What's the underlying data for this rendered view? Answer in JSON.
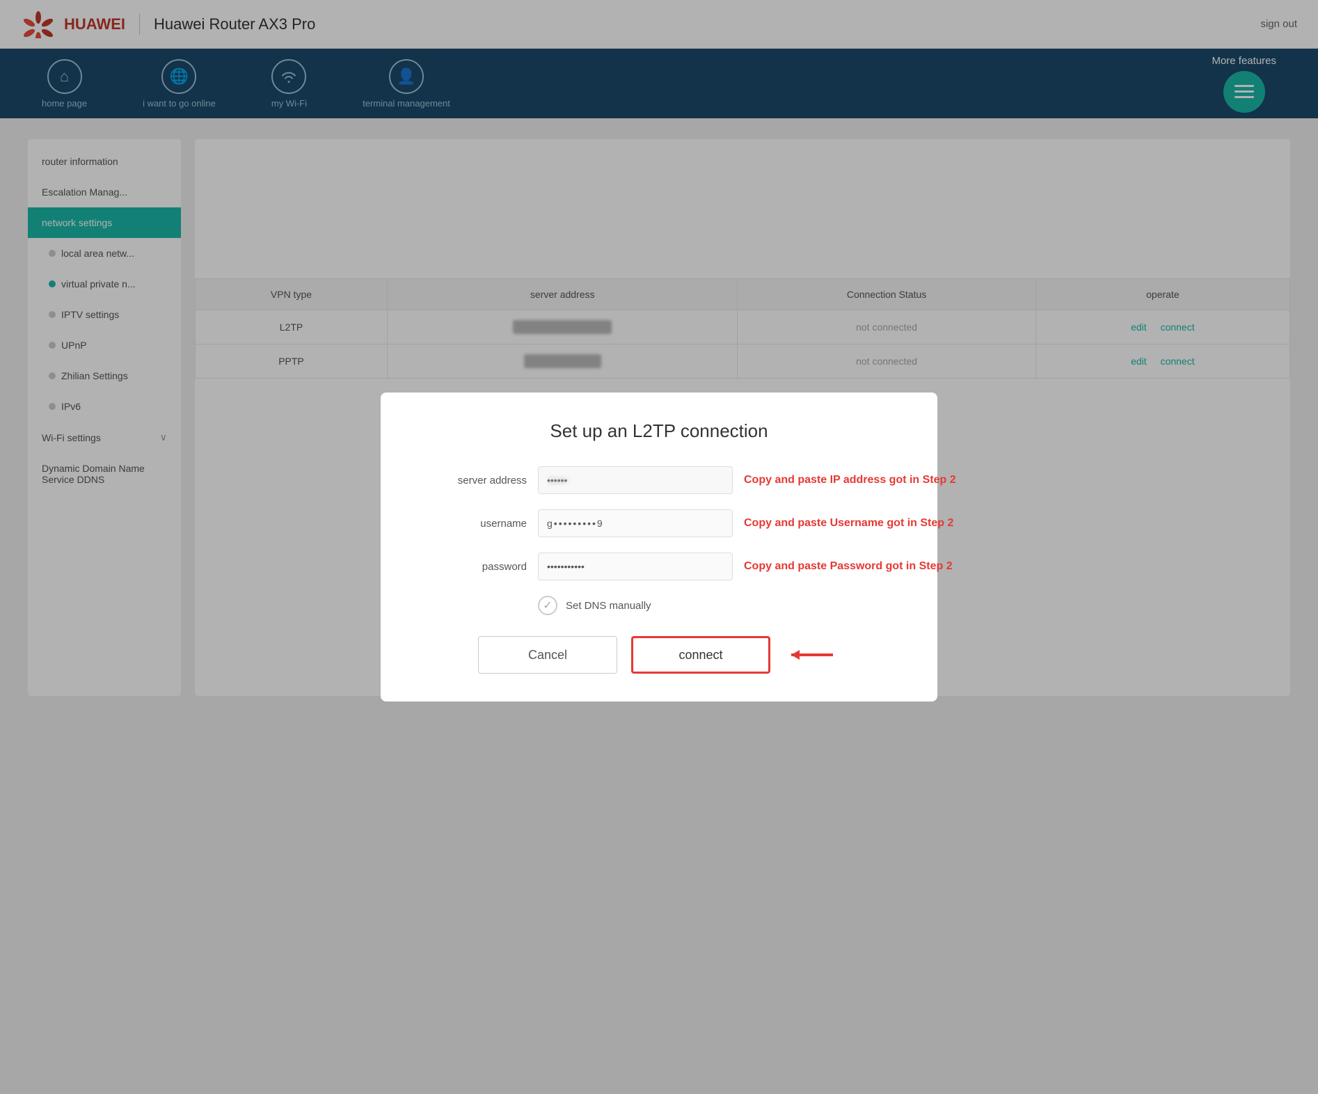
{
  "header": {
    "title": "Huawei Router AX3 Pro",
    "signout": "sign out"
  },
  "nav": {
    "items": [
      {
        "id": "home",
        "label": "home page",
        "icon": "⌂"
      },
      {
        "id": "online",
        "label": "i want to go online",
        "icon": "🌐"
      },
      {
        "id": "wifi",
        "label": "my Wi-Fi",
        "icon": "📶"
      },
      {
        "id": "terminal",
        "label": "terminal management",
        "icon": "👤"
      }
    ],
    "more_label": "More features"
  },
  "sidebar": {
    "items": [
      {
        "id": "router-info",
        "label": "router information",
        "active": false
      },
      {
        "id": "escalation",
        "label": "Escalation Manag...",
        "active": false
      },
      {
        "id": "network-settings",
        "label": "network settings",
        "active": true
      },
      {
        "id": "local-area",
        "label": "local area netw...",
        "active": false,
        "sub": true
      },
      {
        "id": "virtual-private",
        "label": "virtual private n...",
        "active": false,
        "sub": true,
        "dot_active": true
      },
      {
        "id": "iptv",
        "label": "IPTV settings",
        "active": false,
        "sub": true
      },
      {
        "id": "upnp",
        "label": "UPnP",
        "active": false,
        "sub": true
      },
      {
        "id": "zhilian",
        "label": "Zhilian Settings",
        "active": false,
        "sub": true
      },
      {
        "id": "ipv6",
        "label": "IPv6",
        "active": false,
        "sub": true
      },
      {
        "id": "wifi-settings",
        "label": "Wi-Fi settings",
        "active": false,
        "has_arrow": true
      },
      {
        "id": "ddns",
        "label": "Dynamic Domain Name Service DDNS",
        "active": false
      }
    ]
  },
  "modal": {
    "title": "Set up an L2TP connection",
    "fields": [
      {
        "id": "server-address",
        "label": "server address",
        "type": "blurred",
        "placeholder": "••••••••",
        "hint": "Copy and paste IP address got in Step 2"
      },
      {
        "id": "username",
        "label": "username",
        "type": "blurred",
        "placeholder": "g•••••••••9",
        "hint": "Copy and paste Username got in Step 2"
      },
      {
        "id": "password",
        "label": "password",
        "type": "password",
        "placeholder": "••••••••",
        "hint": "Copy and paste Password got in Step 2"
      }
    ],
    "dns_label": "Set DNS manually",
    "cancel_btn": "Cancel",
    "connect_btn": "connect"
  },
  "vpn_table": {
    "headers": [
      "VPN type",
      "server address",
      "Connection Status",
      "operate"
    ],
    "rows": [
      {
        "type": "L2TP",
        "address": "blurred",
        "status": "not connected",
        "ops": [
          "edit",
          "connect"
        ]
      },
      {
        "type": "PPTP",
        "address": "blurred2",
        "status": "not connected",
        "ops": [
          "edit",
          "connect"
        ]
      }
    ]
  }
}
